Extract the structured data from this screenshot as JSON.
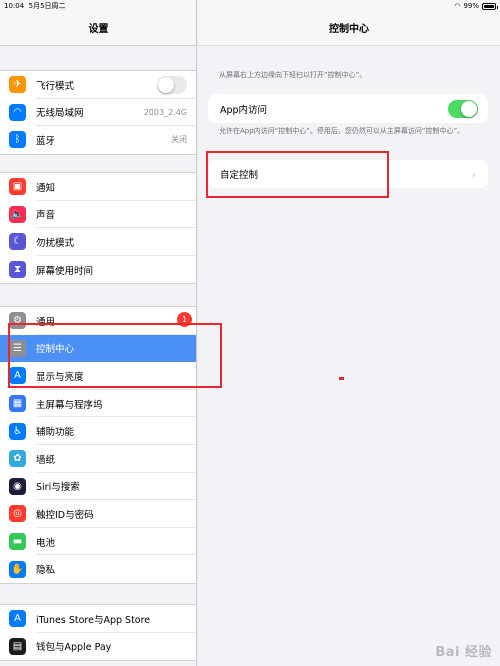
{
  "status": {
    "time": "10:04",
    "date": "5月5日周二",
    "battery": "99%"
  },
  "sidebar": {
    "title": "设置",
    "groups": [
      [
        {
          "label": "飞行模式",
          "color": "#ff9500",
          "icon": "airplane-icon",
          "glyph": "✈",
          "accessory": "toggle-off"
        },
        {
          "label": "无线局域网",
          "color": "#007aff",
          "icon": "wifi-icon",
          "glyph": "◠",
          "value": "2003_2.4G"
        },
        {
          "label": "蓝牙",
          "color": "#007aff",
          "icon": "bluetooth-icon",
          "glyph": "ᛒ",
          "value": "关闭"
        }
      ],
      [
        {
          "label": "通知",
          "color": "#ff3b30",
          "icon": "notifications-icon",
          "glyph": "▣"
        },
        {
          "label": "声音",
          "color": "#ff2d55",
          "icon": "sound-icon",
          "glyph": "🔈"
        },
        {
          "label": "勿扰模式",
          "color": "#5856d6",
          "icon": "moon-icon",
          "glyph": "☾"
        },
        {
          "label": "屏幕使用时间",
          "color": "#5856d6",
          "icon": "hourglass-icon",
          "glyph": "⧗"
        }
      ],
      [
        {
          "label": "通用",
          "color": "#8e8e93",
          "icon": "gear-icon",
          "glyph": "⚙",
          "badge": "1"
        },
        {
          "label": "控制中心",
          "color": "#8e8e93",
          "icon": "control-center-icon",
          "glyph": "☰",
          "selected": true
        },
        {
          "label": "显示与亮度",
          "color": "#007aff",
          "icon": "display-icon",
          "glyph": "A"
        },
        {
          "label": "主屏幕与程序坞",
          "color": "#3478f6",
          "icon": "home-screen-icon",
          "glyph": "▦"
        },
        {
          "label": "辅助功能",
          "color": "#007aff",
          "icon": "accessibility-icon",
          "glyph": "♿"
        },
        {
          "label": "墙纸",
          "color": "#34aadc",
          "icon": "wallpaper-icon",
          "glyph": "✿"
        },
        {
          "label": "Siri与搜索",
          "color": "#1c1c3a",
          "icon": "siri-icon",
          "glyph": "◉"
        },
        {
          "label": "触控ID与密码",
          "color": "#ff3b30",
          "icon": "fingerprint-icon",
          "glyph": "◎"
        },
        {
          "label": "电池",
          "color": "#34c759",
          "icon": "battery-icon",
          "glyph": "▬"
        },
        {
          "label": "隐私",
          "color": "#007aff",
          "icon": "hand-icon",
          "glyph": "✋"
        }
      ],
      [
        {
          "label": "iTunes Store与App Store",
          "color": "#007aff",
          "icon": "app-store-icon",
          "glyph": "A"
        },
        {
          "label": "钱包与Apple Pay",
          "color": "#1c1c1e",
          "icon": "wallet-icon",
          "glyph": "▤"
        }
      ]
    ]
  },
  "main": {
    "title": "控制中心",
    "caption1": "从屏幕右上方边缘向下轻扫以打开“控制中心”。",
    "app_access_label": "App内访问",
    "caption2": "允许在App内访问“控制中心”。停用后，您仍然可以从主屏幕访问“控制中心”。",
    "customize_label": "自定控制"
  },
  "watermark": "Bai 经验"
}
